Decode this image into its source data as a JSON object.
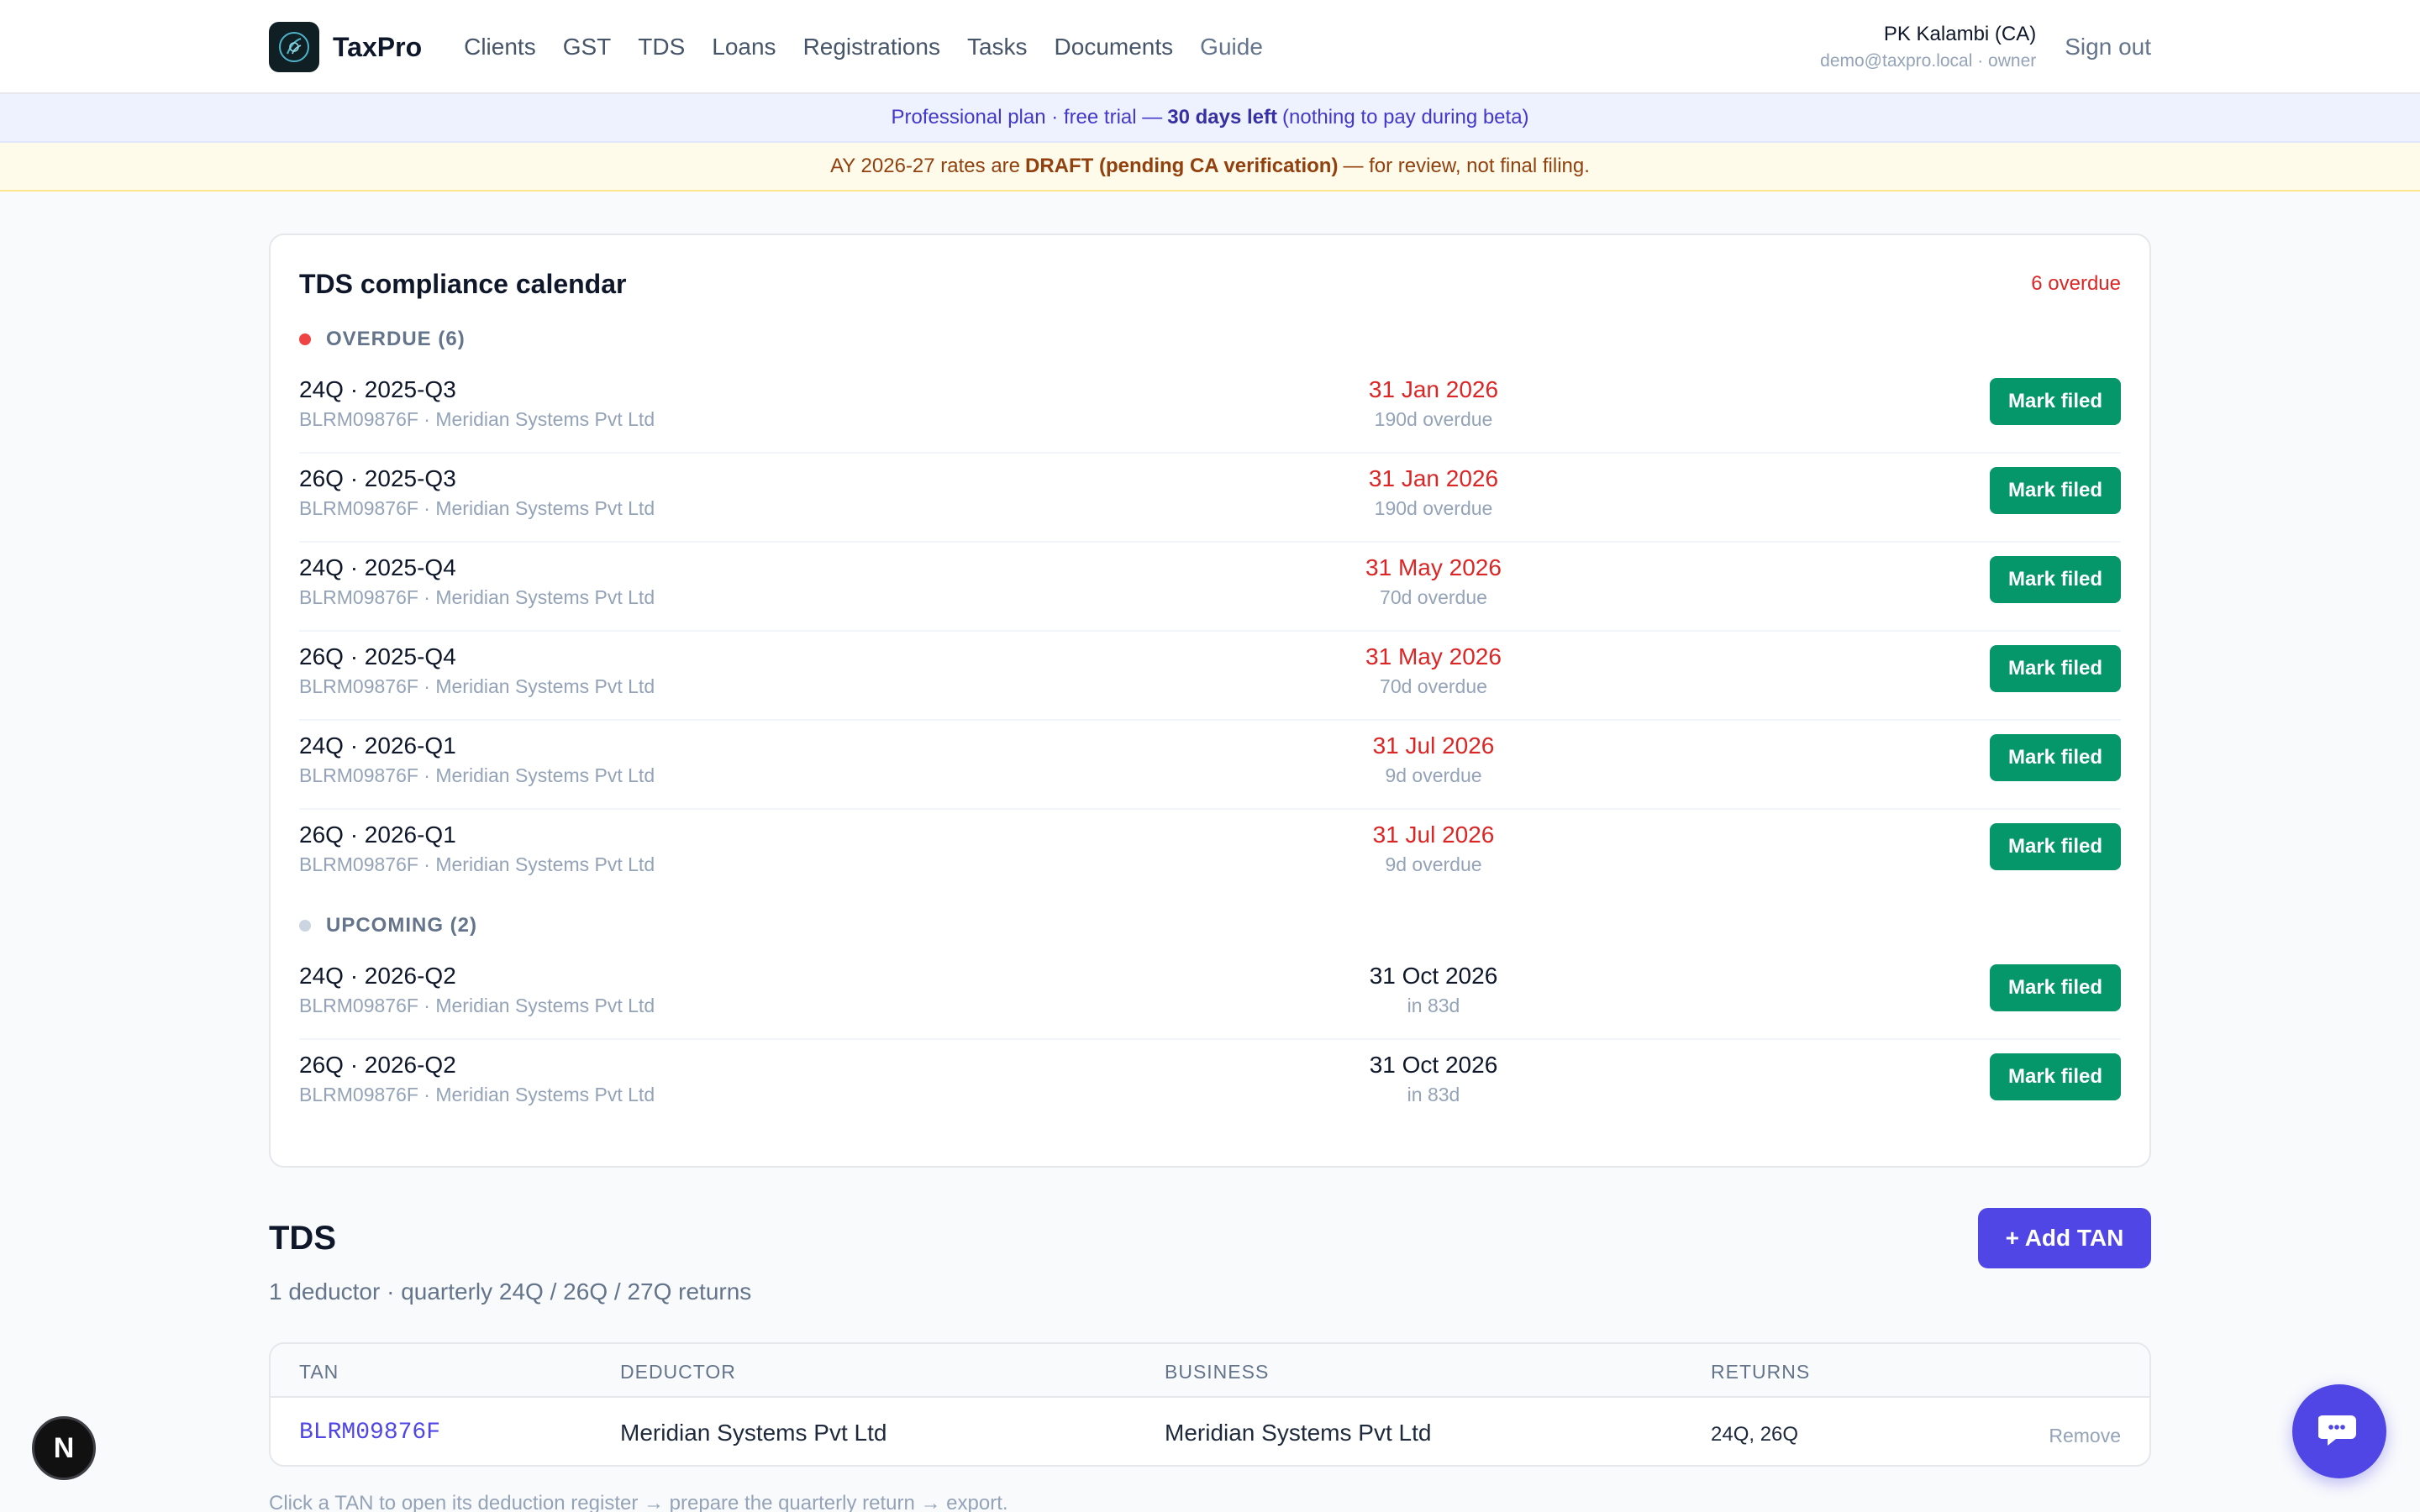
{
  "header": {
    "brand": "TaxPro",
    "nav": [
      "Clients",
      "GST",
      "TDS",
      "Loans",
      "Registrations",
      "Tasks",
      "Documents",
      "Guide"
    ],
    "user_name": "PK Kalambi (CA)",
    "user_sub": "demo@taxpro.local · owner",
    "sign_out": "Sign out"
  },
  "plan_banner": {
    "prefix": "Professional plan · free trial —",
    "highlight": "30 days left",
    "suffix": "(nothing to pay during beta)"
  },
  "draft_banner": {
    "prefix": "AY 2026-27 rates are",
    "highlight": "DRAFT (pending CA verification)",
    "suffix": "— for review, not final filing."
  },
  "calendar": {
    "title": "TDS compliance calendar",
    "overdue_count": "6 overdue",
    "overdue_heading": "OVERDUE (6)",
    "upcoming_heading": "UPCOMING (2)",
    "mark_filed_label": "Mark filed",
    "overdue": [
      {
        "title": "24Q · 2025-Q3",
        "sub": "BLRM09876F · Meridian Systems Pvt Ltd",
        "date": "31 Jan 2026",
        "rel": "190d overdue"
      },
      {
        "title": "26Q · 2025-Q3",
        "sub": "BLRM09876F · Meridian Systems Pvt Ltd",
        "date": "31 Jan 2026",
        "rel": "190d overdue"
      },
      {
        "title": "24Q · 2025-Q4",
        "sub": "BLRM09876F · Meridian Systems Pvt Ltd",
        "date": "31 May 2026",
        "rel": "70d overdue"
      },
      {
        "title": "26Q · 2025-Q4",
        "sub": "BLRM09876F · Meridian Systems Pvt Ltd",
        "date": "31 May 2026",
        "rel": "70d overdue"
      },
      {
        "title": "24Q · 2026-Q1",
        "sub": "BLRM09876F · Meridian Systems Pvt Ltd",
        "date": "31 Jul 2026",
        "rel": "9d overdue"
      },
      {
        "title": "26Q · 2026-Q1",
        "sub": "BLRM09876F · Meridian Systems Pvt Ltd",
        "date": "31 Jul 2026",
        "rel": "9d overdue"
      }
    ],
    "upcoming": [
      {
        "title": "24Q · 2026-Q2",
        "sub": "BLRM09876F · Meridian Systems Pvt Ltd",
        "date": "31 Oct 2026",
        "rel": "in 83d"
      },
      {
        "title": "26Q · 2026-Q2",
        "sub": "BLRM09876F · Meridian Systems Pvt Ltd",
        "date": "31 Oct 2026",
        "rel": "in 83d"
      }
    ]
  },
  "tds": {
    "title": "TDS",
    "subtitle": "1 deductor · quarterly 24Q / 26Q / 27Q returns",
    "add_button": "+ Add TAN",
    "columns": [
      "TAN",
      "DEDUCTOR",
      "BUSINESS",
      "RETURNS"
    ],
    "rows": [
      {
        "tan": "BLRM09876F",
        "deductor": "Meridian Systems Pvt Ltd",
        "business": "Meridian Systems Pvt Ltd",
        "returns": "24Q, 26Q",
        "action": "Remove"
      }
    ],
    "hint": "Click a TAN to open its deduction register → prepare the quarterly return → export."
  },
  "floating": {
    "next_badge": "N"
  },
  "colors": {
    "accent": "#4f46e5",
    "success": "#059669",
    "danger": "#dc2626",
    "upcoming_dot": "#cbd5e1"
  },
  "icons": {
    "logo": "taxpro-logo-icon",
    "chat": "chat-bubble-icon"
  }
}
